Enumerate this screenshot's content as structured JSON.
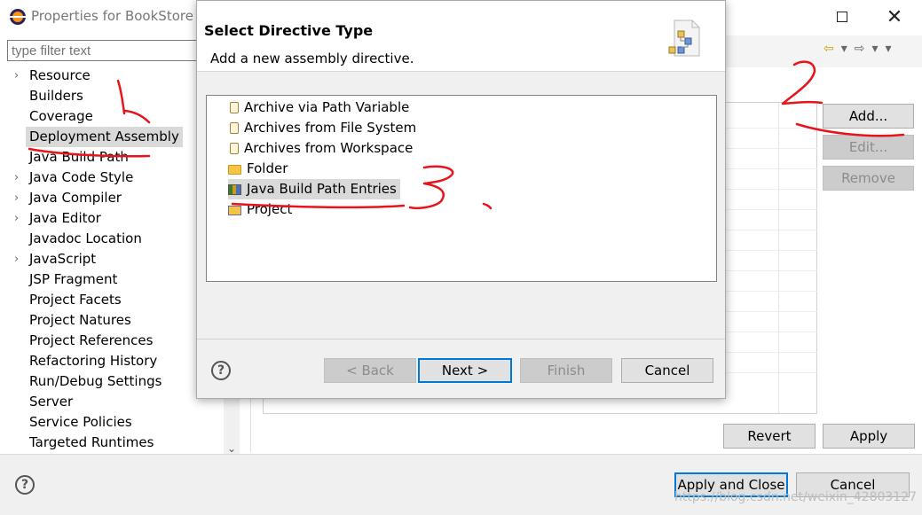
{
  "window": {
    "title": "Properties for BookStore"
  },
  "filter": {
    "placeholder": "type filter text"
  },
  "tree": {
    "items": [
      {
        "label": "Resource",
        "expandable": true
      },
      {
        "label": "Builders",
        "expandable": false
      },
      {
        "label": "Coverage",
        "expandable": false
      },
      {
        "label": "Deployment Assembly",
        "expandable": false,
        "selected": true
      },
      {
        "label": "Java Build Path",
        "expandable": false
      },
      {
        "label": "Java Code Style",
        "expandable": true
      },
      {
        "label": "Java Compiler",
        "expandable": true
      },
      {
        "label": "Java Editor",
        "expandable": true
      },
      {
        "label": "Javadoc Location",
        "expandable": false
      },
      {
        "label": "JavaScript",
        "expandable": true
      },
      {
        "label": "JSP Fragment",
        "expandable": false
      },
      {
        "label": "Project Facets",
        "expandable": false
      },
      {
        "label": "Project Natures",
        "expandable": false
      },
      {
        "label": "Project References",
        "expandable": false
      },
      {
        "label": "Refactoring History",
        "expandable": false
      },
      {
        "label": "Run/Debug Settings",
        "expandable": false
      },
      {
        "label": "Server",
        "expandable": false
      },
      {
        "label": "Service Policies",
        "expandable": false
      },
      {
        "label": "Targeted Runtimes",
        "expandable": false
      }
    ]
  },
  "side_buttons": {
    "add": "Add...",
    "edit": "Edit...",
    "remove": "Remove"
  },
  "page_buttons": {
    "revert": "Revert",
    "apply": "Apply"
  },
  "bottom_buttons": {
    "apply_close": "Apply and Close",
    "cancel": "Cancel"
  },
  "watermark": "https://blog.csdn.net/weixin_42803127",
  "dialog": {
    "title": "Select Directive Type",
    "description": "Add a new assembly directive.",
    "items": [
      {
        "label": "Archive via Path Variable",
        "icon": "jar-icon"
      },
      {
        "label": "Archives from File System",
        "icon": "jar-icon"
      },
      {
        "label": "Archives from Workspace",
        "icon": "jar-icon"
      },
      {
        "label": "Folder",
        "icon": "folder-icon"
      },
      {
        "label": "Java Build Path Entries",
        "icon": "library-icon",
        "selected": true
      },
      {
        "label": "Project",
        "icon": "project-icon"
      }
    ],
    "buttons": {
      "back": "< Back",
      "next": "Next >",
      "finish": "Finish",
      "cancel": "Cancel"
    }
  },
  "annotations": [
    "1",
    "2",
    "3"
  ],
  "colors": {
    "annotation": "#e8141c",
    "selection": "#d9d9d9",
    "focus": "#0078d7"
  }
}
